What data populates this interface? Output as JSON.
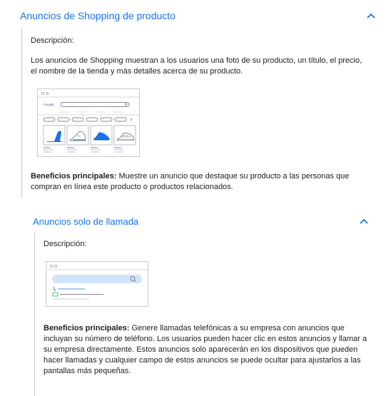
{
  "section1": {
    "title": "Anuncios de Shopping de producto",
    "description_label": "Descripción:",
    "description_text": "Los anuncios de Shopping muestran a los usuarios una foto de su producto, un título, el precio, el nombre de la tienda y más detalles acerca de su producto.",
    "benefits_label": "Beneficios principales:",
    "benefits_text": " Muestre un anuncio que destaque su producto a las personas que compran en línea este producto o productos relacionados.",
    "illustration": {
      "logo_text": "Google"
    }
  },
  "section2": {
    "title": "Anuncios solo de llamada",
    "description_label": "Descripción:",
    "benefits_label": "Beneficios principales:",
    "benefits_text": " Genere llamadas telefónicas a su empresa con anuncios que incluyan su número de teléfono. Los usuarios pueden hacer clic en estos anuncios y llamar a su empresa directamente. Estos anuncios solo aparecerán en los dispositivos que pueden hacer llamadas y cualquier campo de estos anuncios se puede ocultar para ajustarlos a las pantallas más pequeñas."
  },
  "colors": {
    "accent": "#1a73e8",
    "text": "#202124",
    "border": "#c8c8c8"
  }
}
